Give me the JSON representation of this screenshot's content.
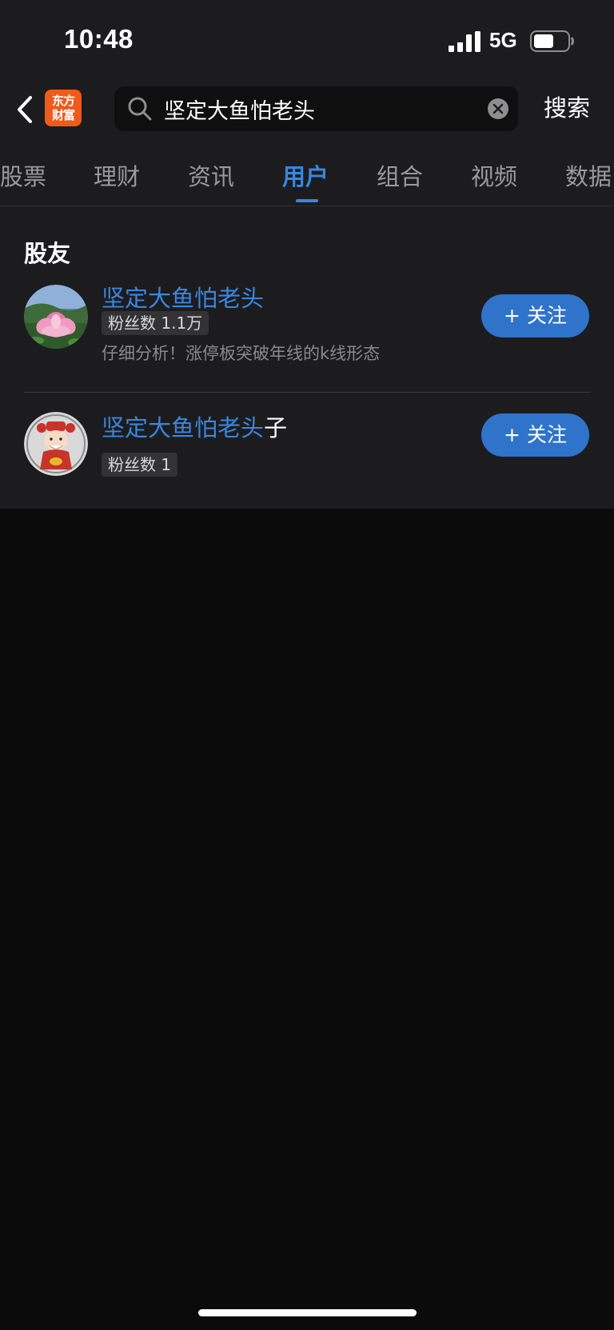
{
  "status_bar": {
    "time": "10:48",
    "network": "5G",
    "battery_level": 0.6
  },
  "header": {
    "app_logo_line1": "东方",
    "app_logo_line2": "财富",
    "search_value": "坚定大鱼怕老头",
    "search_button": "搜索"
  },
  "tabs": [
    {
      "label": "股票"
    },
    {
      "label": "理财"
    },
    {
      "label": "资讯"
    },
    {
      "label": "用户",
      "active": true
    },
    {
      "label": "组合"
    },
    {
      "label": "视频"
    },
    {
      "label": "数据"
    }
  ],
  "section": {
    "title": "股友"
  },
  "users": [
    {
      "name_match": "坚定大鱼怕老头",
      "name_suffix": "",
      "fans": "粉丝数 1.1万",
      "desc": "仔细分析！涨停板突破年线的k线形态",
      "follow": "+ 关注",
      "avatar": "lotus-flower"
    },
    {
      "name_match": "坚定大鱼怕老头",
      "name_suffix": "子",
      "fans": "粉丝数 1",
      "desc": "",
      "follow": "+ 关注",
      "avatar": "fortune-god-cartoon"
    }
  ],
  "colors": {
    "accent": "#3a86e0",
    "follow_button": "#2f73cb",
    "logo": "#f05a1a",
    "panel": "#1c1c1e",
    "background": "#0b0b0c"
  }
}
